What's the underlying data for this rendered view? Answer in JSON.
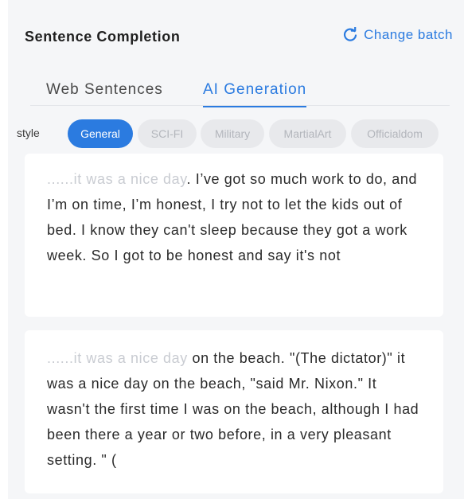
{
  "header": {
    "title": "Sentence Completion",
    "change_batch_label": "Change batch"
  },
  "tabs": [
    {
      "label": "Web Sentences",
      "active": false
    },
    {
      "label": "AI Generation",
      "active": true
    }
  ],
  "style_filter": {
    "label": "style",
    "options": [
      {
        "label": "General",
        "active": true
      },
      {
        "label": "SCI-FI",
        "active": false
      },
      {
        "label": "Military",
        "active": false
      },
      {
        "label": "MartialArt",
        "active": false
      },
      {
        "label": "Officialdom",
        "active": false
      }
    ]
  },
  "results": [
    {
      "prefix": "......it was a nice day",
      "completion": ". I’ve got so much work to do, and I’m on time, I’m honest, I try not to let the kids out of bed. I know they can't sleep because they got a work week. So I got to be honest and say it's not"
    },
    {
      "prefix": "......it was a nice day",
      "completion": " on the beach. \"(The dictator)\" it was a nice day on the beach, \"said Mr. Nixon.\" It wasn't the first time I was on the beach, although I had been there a year or two before, in a very pleasant setting. \" ("
    }
  ],
  "colors": {
    "accent": "#2b7be0",
    "background": "#f5f6f8",
    "muted_text": "#c9ccd2",
    "chip_inactive_bg": "#e8e9ec"
  }
}
